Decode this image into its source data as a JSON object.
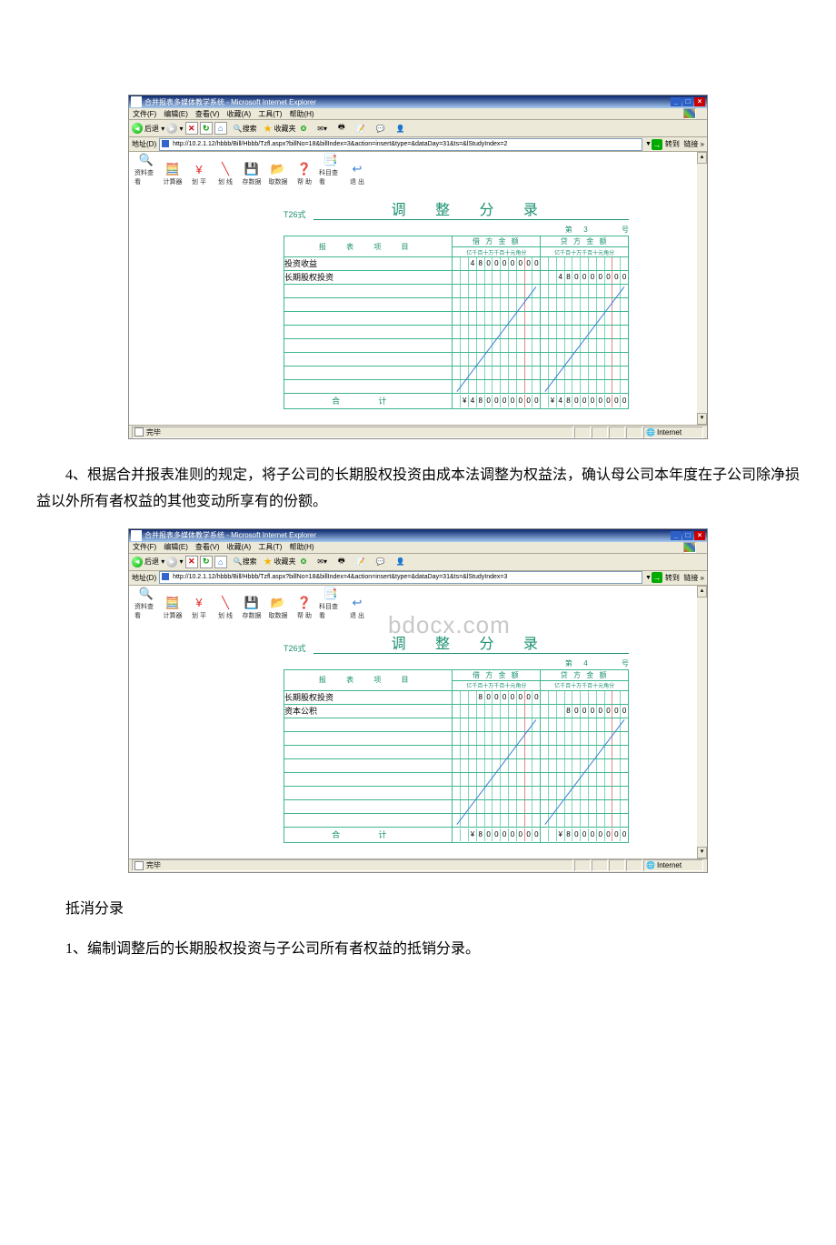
{
  "ie": {
    "title": "合并报表多媒体教学系统 - Microsoft Internet Explorer",
    "menu": {
      "file": "文件(F)",
      "edit": "编辑(E)",
      "view": "查看(V)",
      "fav": "收藏(A)",
      "tools": "工具(T)",
      "help": "帮助(H)"
    },
    "toolbar": {
      "back": "后退",
      "search": "搜索",
      "fav": "收藏夹"
    },
    "addr_label": "地址(D)",
    "go": "转到",
    "links": "链接 »",
    "status_done": "完毕",
    "status_zone": "Internet",
    "url1": "http://10.2.1.12/hbbb/Bill/Hbbb/Tzfl.aspx?billNo=18&billIndex=3&action=insert&type=&dataDay=31&ts=&lStudyIndex=2",
    "url2": "http://10.2.1.12/hbbb/Bill/Hbbb/Tzfl.aspx?billNo=18&billIndex=4&action=insert&type=&dataDay=31&ts=&lStudyIndex=3"
  },
  "app": {
    "btns": {
      "b1": "资料查看",
      "b2": "计算器",
      "b3": "划 平",
      "b4": "划 线",
      "b5": "存数据",
      "b6": "取数据",
      "b7": "帮 助",
      "b8": "科目查看",
      "b9": "退 出"
    }
  },
  "ledger": {
    "sublabel": "T26式",
    "title": "调 整 分 录",
    "meta_prefix": "第",
    "meta_suffix": "号",
    "header_item": "报 表 项 目",
    "header_debit": "借 方 金 额",
    "header_credit": "贷 方 金 额",
    "digits_header": "亿千百十万千百十元角分",
    "total_label": "合  计",
    "yen": "¥"
  },
  "entries": [
    {
      "page_no": "3",
      "rows": [
        {
          "item": "投资收益",
          "debit": "480000000",
          "credit": ""
        },
        {
          "item": "长期股权投资",
          "debit": "",
          "credit": "480000000"
        }
      ],
      "total_debit": "480000000",
      "total_credit": "480000000"
    },
    {
      "page_no": "4",
      "rows": [
        {
          "item": "长期股权投资",
          "debit": "80000000",
          "credit": ""
        },
        {
          "item": "资本公积",
          "debit": "",
          "credit": "80000000"
        }
      ],
      "total_debit": "80000000",
      "total_credit": "80000000"
    }
  ],
  "text": {
    "p1": "4、根据合并报表准则的规定，将子公司的长期股权投资由成本法调整为权益法，确认母公司本年度在子公司除净损益以外所有者权益的其他变动所享有的份额。",
    "p2": "抵消分录",
    "p3": "1、编制调整后的长期股权投资与子公司所有者权益的抵销分录。"
  },
  "watermark": "bdocx.com"
}
